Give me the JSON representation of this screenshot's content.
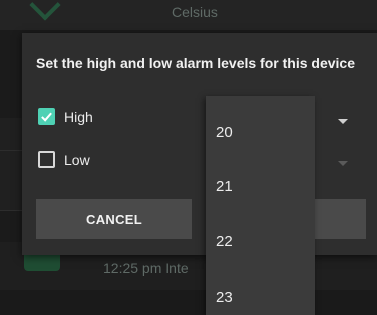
{
  "background": {
    "top_text": "Celsius",
    "bottom_text": "12:25 pm Inte"
  },
  "dialog": {
    "title": "Set the high and low alarm levels for this device",
    "high": {
      "label": "High",
      "checked": true
    },
    "low": {
      "label": "Low",
      "checked": false
    },
    "cancel_label": "CANCEL"
  },
  "dropdown": {
    "options": [
      "20",
      "21",
      "22",
      "23"
    ]
  },
  "colors": {
    "accent": "#4fd1b4",
    "dialog_bg": "#2e2e2e",
    "dropdown_bg": "#3b3b3b",
    "button_bg": "#4a4a4a"
  }
}
